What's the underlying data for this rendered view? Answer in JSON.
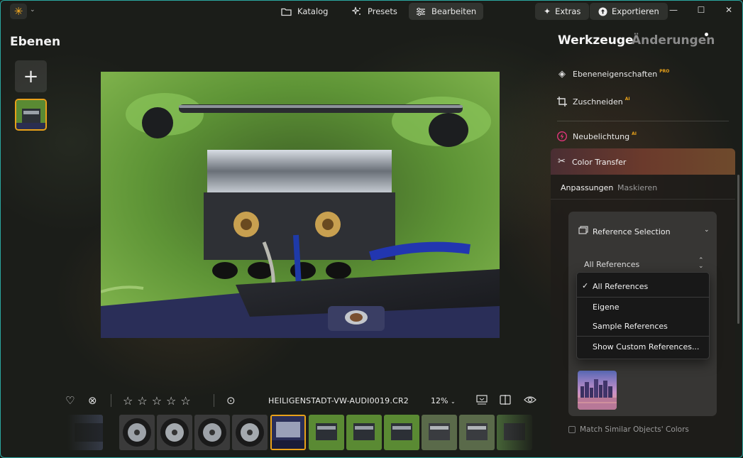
{
  "topbar": {
    "nav": [
      {
        "label": "Katalog",
        "icon": "folder-icon"
      },
      {
        "label": "Presets",
        "icon": "sparkle-icon"
      },
      {
        "label": "Bearbeiten",
        "icon": "sliders-icon"
      }
    ],
    "extras_label": "Extras",
    "export_label": "Exportieren"
  },
  "left": {
    "title": "Ebenen"
  },
  "bottom": {
    "filename": "HEILIGENSTADT-VW-AUDI0019.CR2",
    "zoom": "12%"
  },
  "right": {
    "tab_tools": "Werkzeuge",
    "tab_changes": "Änderungen",
    "tools": [
      {
        "label": "Ebeneneigenschaften",
        "badge": "PRO",
        "icon": "layers-icon"
      },
      {
        "label": "Zuschneiden",
        "badge": "AI",
        "icon": "crop-icon"
      },
      {
        "label": "Neubelichtung",
        "badge": "AI",
        "icon": "relight-icon"
      }
    ],
    "color_transfer": {
      "title": "Color Transfer",
      "subtabs": [
        "Anpassungen",
        "Maskieren"
      ],
      "reference_selection": "Reference Selection",
      "selected_reference": "All References",
      "match_label": "Match Similar Objects' Colors"
    }
  },
  "dropdown": {
    "items": [
      "All References",
      "Eigene",
      "Sample References",
      "Show Custom References..."
    ],
    "checked": "All References"
  },
  "colors": {
    "accent": "#e8a11a",
    "frame": "#2aa7a0"
  }
}
